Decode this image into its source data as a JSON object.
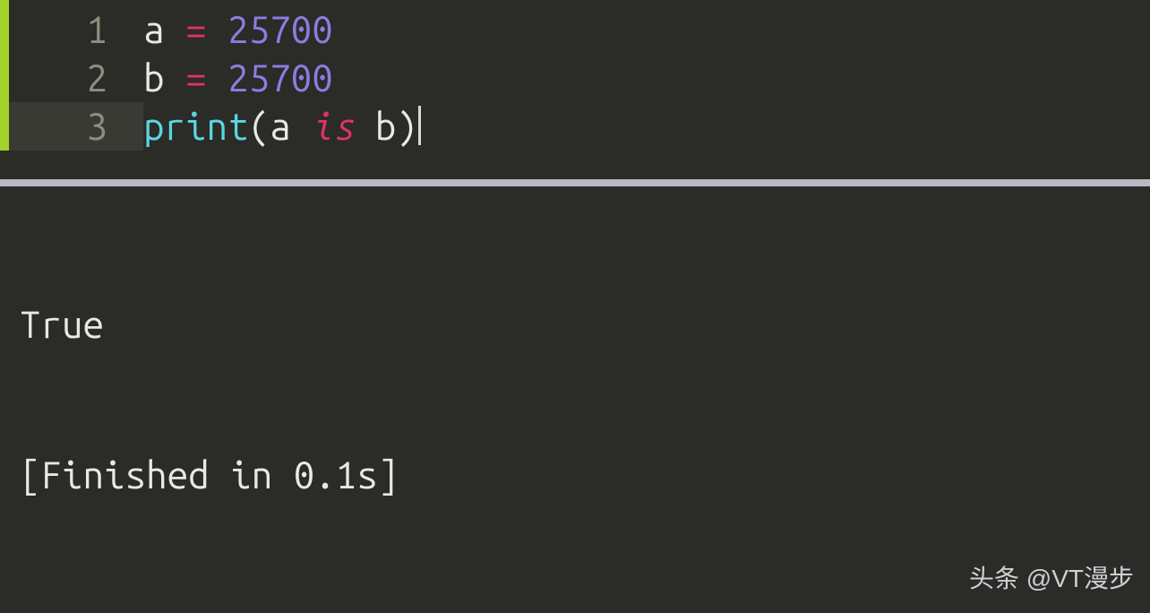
{
  "editor": {
    "lines": [
      {
        "num": "1",
        "current": false,
        "tokens": [
          {
            "cls": "tok-var",
            "text": "a"
          },
          {
            "cls": "",
            "text": " "
          },
          {
            "cls": "tok-op",
            "text": "="
          },
          {
            "cls": "",
            "text": " "
          },
          {
            "cls": "tok-num",
            "text": "25700"
          }
        ]
      },
      {
        "num": "2",
        "current": false,
        "tokens": [
          {
            "cls": "tok-var",
            "text": "b"
          },
          {
            "cls": "",
            "text": " "
          },
          {
            "cls": "tok-op",
            "text": "="
          },
          {
            "cls": "",
            "text": " "
          },
          {
            "cls": "tok-num",
            "text": "25700"
          }
        ]
      },
      {
        "num": "3",
        "current": true,
        "tokens": [
          {
            "cls": "tok-fn",
            "text": "print"
          },
          {
            "cls": "tok-pn",
            "text": "("
          },
          {
            "cls": "tok-var",
            "text": "a"
          },
          {
            "cls": "",
            "text": " "
          },
          {
            "cls": "tok-kw",
            "text": "is"
          },
          {
            "cls": "",
            "text": " "
          },
          {
            "cls": "tok-var",
            "text": "b"
          },
          {
            "cls": "tok-pn",
            "text": ")"
          }
        ],
        "cursorAfter": true
      }
    ]
  },
  "console": {
    "output": "True",
    "finished": "[Finished in 0.1s]"
  },
  "watermark": "头条 @VT漫步"
}
